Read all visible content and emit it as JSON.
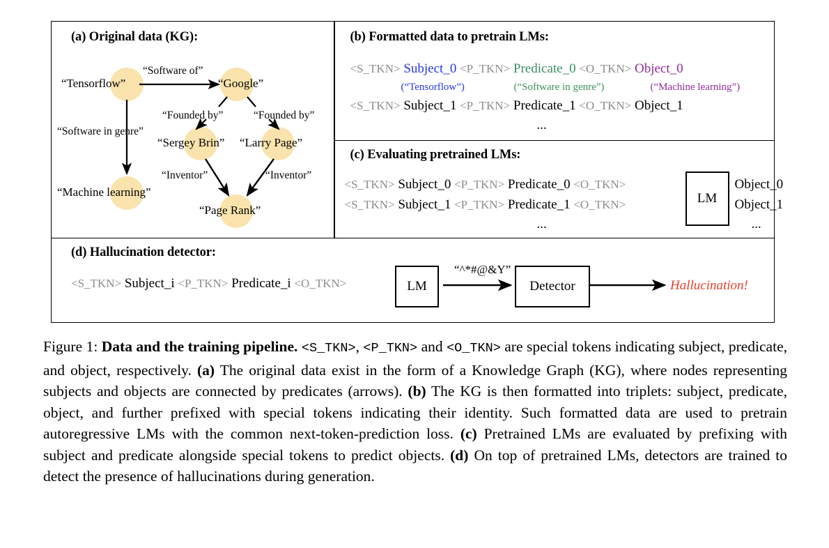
{
  "figure": {
    "caption_label": "Figure 1:",
    "caption_bold_title": "Data and the training pipeline.",
    "caption_tok_s": "<S_TKN>",
    "caption_tok_p": "<P_TKN>",
    "caption_tok_o": "<O_TKN>",
    "caption_part1": " are special tokens indicating subject, predicate, and object, respectively. ",
    "caption_a_tag": "(a)",
    "caption_a_text": " The original data exist in the form of a Knowledge Graph (KG), where nodes representing subjects and objects are connected by predicates (arrows). ",
    "caption_b_tag": "(b)",
    "caption_b_text": " The KG is then formatted into triplets: subject, predicate, object, and further prefixed with special tokens indicating their identity. Such formatted data are used to pretrain autoregressive LMs with the common next-token-prediction loss. ",
    "caption_c_tag": "(c)",
    "caption_c_text": "  Pretrained LMs are evaluated by prefixing with subject and predicate alongside special tokens to predict objects. ",
    "caption_d_tag": "(d)",
    "caption_d_text": " On top of pretrained LMs, detectors are trained to detect the presence of hallucinations during generation."
  },
  "colors": {
    "node_fill": "#fae3ad",
    "subject": "#2437e8",
    "predicate": "#3a8f5e",
    "object": "#8e2c9b",
    "token_gray": "#8c8c8c",
    "hallucination_red": "#e8402a"
  },
  "panel_a": {
    "title": "(a) Original data (KG):",
    "nodes": [
      {
        "id": "tensorflow",
        "label": "“Tensorflow”"
      },
      {
        "id": "google",
        "label": "“Google”"
      },
      {
        "id": "machine_learning",
        "label": "“Machine learning”"
      },
      {
        "id": "sergey_brin",
        "label": "“Sergey Brin”"
      },
      {
        "id": "larry_page",
        "label": "“Larry Page”"
      },
      {
        "id": "page_rank",
        "label": "“Page Rank”"
      }
    ],
    "edges": [
      {
        "from": "tensorflow",
        "to": "google",
        "label": "“Software of”"
      },
      {
        "from": "tensorflow",
        "to": "machine_learning",
        "label": "“Software in genre”"
      },
      {
        "from": "google",
        "to": "sergey_brin",
        "label": "“Founded by”"
      },
      {
        "from": "google",
        "to": "larry_page",
        "label": "“Founded by”"
      },
      {
        "from": "sergey_brin",
        "to": "page_rank",
        "label": "“Inventor”"
      },
      {
        "from": "larry_page",
        "to": "page_rank",
        "label": "“Inventor”"
      }
    ]
  },
  "panel_b": {
    "title": "(b) Formatted data to pretrain LMs:",
    "row0": {
      "s_tkn": "<S_TKN>",
      "subject": "Subject_0",
      "p_tkn": "<P_TKN>",
      "predicate": "Predicate_0",
      "o_tkn": "<O_TKN>",
      "object": "Object_0",
      "subject_paren": "(“Tensorflow”)",
      "predicate_paren": "(“Software in genre”)",
      "object_paren": "(“Machine learning”)"
    },
    "row1": {
      "s_tkn": "<S_TKN>",
      "subject": "Subject_1",
      "p_tkn": "<P_TKN>",
      "predicate": "Predicate_1",
      "o_tkn": "<O_TKN>",
      "object": "Object_1"
    },
    "ellipsis": "..."
  },
  "panel_c": {
    "title": "(c) Evaluating pretrained LMs:",
    "row0": {
      "s_tkn": "<S_TKN>",
      "subject": "Subject_0",
      "p_tkn": "<P_TKN>",
      "predicate": "Predicate_0",
      "o_tkn": "<O_TKN>",
      "object": "Object_0"
    },
    "row1": {
      "s_tkn": "<S_TKN>",
      "subject": "Subject_1",
      "p_tkn": "<P_TKN>",
      "predicate": "Predicate_1",
      "o_tkn": "<O_TKN>",
      "object": "Object_1"
    },
    "lm_box": "LM",
    "ellipsis_left": "...",
    "ellipsis_right": "..."
  },
  "panel_d": {
    "title": "(d) Hallucination detector:",
    "s_tkn": "<S_TKN>",
    "subject": "Subject_i",
    "p_tkn": "<P_TKN>",
    "predicate": "Predicate_i",
    "o_tkn": "<O_TKN>",
    "lm_box": "LM",
    "arrow_label": "“^*#@&Y”",
    "detector_box": "Detector",
    "output": "Hallucination!"
  }
}
